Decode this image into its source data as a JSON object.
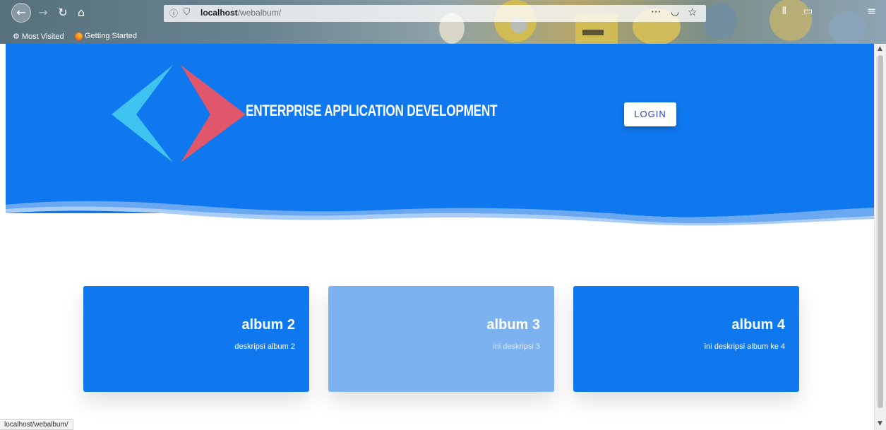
{
  "browser": {
    "url_host": "localhost",
    "url_path": "/webalbum/",
    "bookmarks": [
      "Most Visited",
      "Getting Started"
    ],
    "status_url": "localhost/webalbum/",
    "icons": {
      "back": "back-arrow-icon",
      "forward": "forward-arrow-icon",
      "reload": "reload-icon",
      "home": "home-icon",
      "info": "info-icon",
      "shield": "tracking-shield-icon",
      "more": "page-actions-icon",
      "pocket": "pocket-icon",
      "star": "bookmark-star-icon",
      "library": "library-icon",
      "sidebar": "sidebar-icon",
      "menu": "hamburger-menu-icon"
    }
  },
  "header": {
    "title": "ENTERPRISE APPLICATION DEVELOPMENT",
    "login_label": "LOGIN",
    "colors": {
      "background": "#0f78ef",
      "logo_left": "#3fc3ef",
      "logo_right": "#e0566a"
    }
  },
  "albums": [
    {
      "title": "album 2",
      "description": "deskripsi album 2",
      "color": "#0f78ef"
    },
    {
      "title": "album 3",
      "description": "ini deskripsi 3",
      "color": "#7bb2ef"
    },
    {
      "title": "album 4",
      "description": "ini deskripsi album ke 4",
      "color": "#0f78ef"
    }
  ]
}
